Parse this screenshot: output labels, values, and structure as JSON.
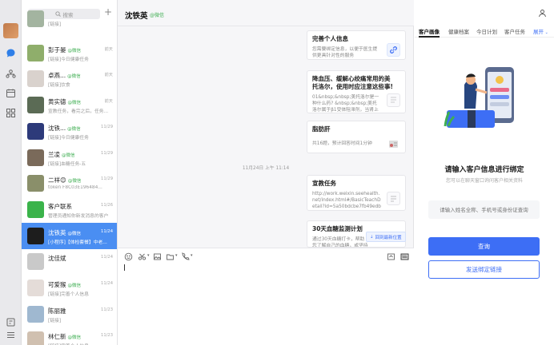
{
  "sidebar_rail": {
    "icons": [
      "avatar",
      "chat-icon",
      "contacts-icon",
      "calendar-icon",
      "apps-icon",
      "tag-icon",
      "menu-icon"
    ]
  },
  "contact_list": {
    "search_placeholder": "搜索",
    "items": [
      {
        "name": "",
        "tag": "",
        "message": "[链接]",
        "time": ""
      },
      {
        "name": "彭于晏",
        "tag": "@微信",
        "message": "[链接]今日健康任务",
        "time": "前天"
      },
      {
        "name": "卓燕...",
        "tag": "@微信",
        "message": "[链接]饮食",
        "time": "前天"
      },
      {
        "name": "黄实德",
        "tag": "@微信",
        "message": "宣教任务，看完之后，任务...",
        "time": "前天"
      },
      {
        "name": "沈铁...",
        "tag": "@微信",
        "message": "[链接]今日健康任务",
        "time": "11/29"
      },
      {
        "name": "兰凌",
        "tag": "@微信",
        "message": "[链接]血糖任务-五",
        "time": "11/29"
      },
      {
        "name": "二祥😊",
        "tag": "@微信",
        "message": "token     F8C03E196484...",
        "time": "11/29"
      },
      {
        "name": "客户联系",
        "tag": "",
        "message": "管理员通知你新发消息的客户",
        "time": "11/26"
      },
      {
        "name": "沈铁英",
        "tag": "@微信",
        "message": "[小程序]【体检套餐】中老...",
        "time": "11/24"
      },
      {
        "name": "沈佳斌",
        "tag": "",
        "message": "",
        "time": "11/24"
      },
      {
        "name": "可爱猴",
        "tag": "@微信",
        "message": "[链接]完善个人信息",
        "time": "11/24"
      },
      {
        "name": "陈丽雅",
        "tag": "",
        "message": "[链接]",
        "time": "11/23"
      },
      {
        "name": "林仁新",
        "tag": "@微信",
        "message": "[链接]完善个人信息",
        "time": "11/23"
      }
    ]
  },
  "chat": {
    "title": "沈铁英",
    "tag": "@微信",
    "timestamp": "11月24日 上午 11:14",
    "cards": [
      {
        "title": "完善个人信息",
        "desc": "您需要绑定信息，以便于医生提供更具针对性的服务"
      },
      {
        "title": "降血压、缓解心绞痛常用的美托洛尔，使用时应注意这些事!",
        "desc": "01&nbsp;&nbsp;美托洛尔是一种什么药? &nbsp;&nbsp;美托洛尔属于β1受体阻滞剂，当肾上腺素"
      },
      {
        "title": "脂肪肝",
        "desc": "共16题，预计回答时间1分钟"
      },
      {
        "title": "宣教任务",
        "desc": "http://work.weixin.seehealth.net/index.html#/BasicTeachDetail?id=5a50bdcbe7fb49edba9704..."
      },
      {
        "title": "30天血糖监测计划",
        "desc": "通过30天血糖打卡，帮助您了解自己的血糖，或坚持测量血糖的习惯，从而更好的进行血糖管理，需要注意以下几点。"
      }
    ],
    "back_to_latest": "回到最新位置"
  },
  "right_panel": {
    "tabs": [
      "客户画像",
      "健康档案",
      "今日计划",
      "客户任务",
      "展开"
    ],
    "heading": "请输入客户信息进行绑定",
    "subheading": "您可以在聊天窗口询问客户相关资料",
    "input_placeholder": "请输入姓名全称、手机号或身份证查询",
    "query_button": "查询",
    "bind_button": "发送绑定链接"
  },
  "colors": {
    "accent": "#3d6ef5",
    "selected": "#4a8ef2",
    "wechat_tag": "#3fae52"
  }
}
